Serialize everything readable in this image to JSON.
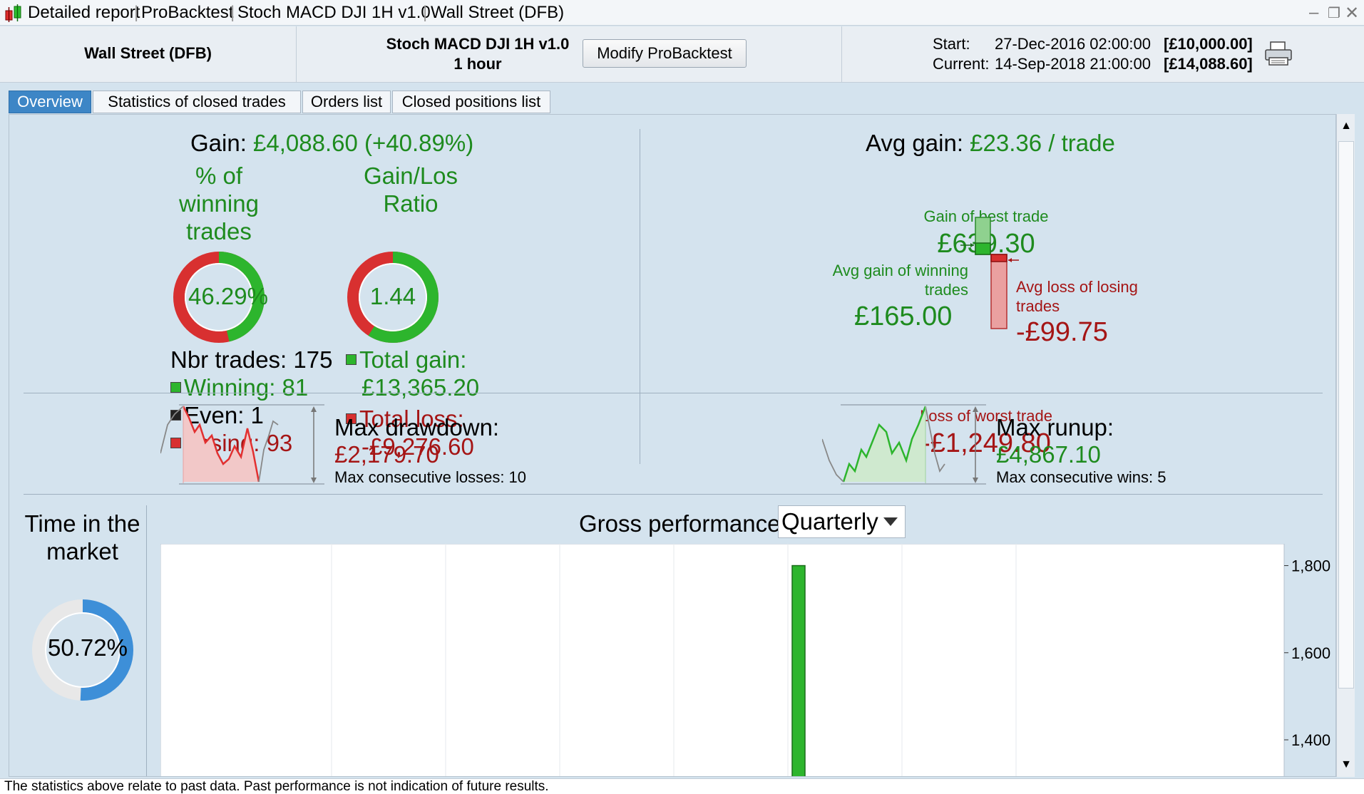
{
  "titlebar": {
    "items": [
      "Detailed report",
      "ProBacktest",
      "Stoch MACD DJI 1H v1.0",
      "Wall Street (DFB)"
    ]
  },
  "header": {
    "instrument": "Wall Street (DFB)",
    "strategy_name": "Stoch MACD DJI 1H v1.0",
    "timeframe": "1 hour",
    "modify_button": "Modify ProBacktest",
    "start_label": "Start:",
    "start_date": "27-Dec-2016 02:00:00",
    "start_capital": "[£10,000.00]",
    "current_label": "Current:",
    "current_date": "14-Sep-2018 21:00:00",
    "current_capital": "[£14,088.60]"
  },
  "tabs": [
    "Overview",
    "Statistics of closed trades",
    "Orders list",
    "Closed positions list"
  ],
  "overview": {
    "gain_label": "Gain:",
    "gain_value": "£4,088.60 (+40.89%)",
    "pct_winning_title": "% of winning trades",
    "pct_winning_value": "46.29%",
    "pct_winning_fraction": 0.4629,
    "gain_loss_title": "Gain/Los Ratio",
    "gain_loss_value": "1.44",
    "gain_loss_fraction": 0.59,
    "nbr_trades": "Nbr trades: 175",
    "winning": "Winning: 81",
    "even": "Even: 1",
    "losing": "Losing: 93",
    "total_gain_label": "Total gain:",
    "total_gain_value": "£13,365.20",
    "total_loss_label": "Total loss:",
    "total_loss_value": "-£9,276.60",
    "avg_gain_label": "Avg gain:",
    "avg_gain_value": "£23.36 / trade",
    "best_trade_label": "Gain of best trade",
    "best_trade_value": "£639.30",
    "avg_win_label": "Avg gain of winning trades",
    "avg_win_value": "£165.00",
    "avg_loss_label": "Avg loss of losing trades",
    "avg_loss_value": "-£99.75",
    "worst_trade_label": "Loss of worst trade",
    "worst_trade_value": "-£1,249.80",
    "max_drawdown_label": "Max drawdown:",
    "max_drawdown_value": "£2,179.70",
    "max_consec_losses": "Max consecutive losses: 10",
    "max_runup_label": "Max runup:",
    "max_runup_value": "£4,867.10",
    "max_consec_wins": "Max consecutive wins: 5",
    "time_in_market_title": "Time in the market",
    "time_in_market_value": "50.72%",
    "time_in_market_fraction": 0.5072,
    "gross_perf_label": "Gross performance",
    "gross_perf_period": "Quarterly"
  },
  "chart_data": {
    "type": "bar",
    "y_ticks": [
      "1,800",
      "1,600",
      "1,400"
    ],
    "values": [
      1800
    ],
    "ylim": [
      1310,
      1850
    ]
  },
  "footer": {
    "text": "The statistics above relate to past data. Past performance is not indication of future results."
  },
  "colors": {
    "win": "#2db52d",
    "loss": "#d83030",
    "accent": "#3d86c6"
  }
}
